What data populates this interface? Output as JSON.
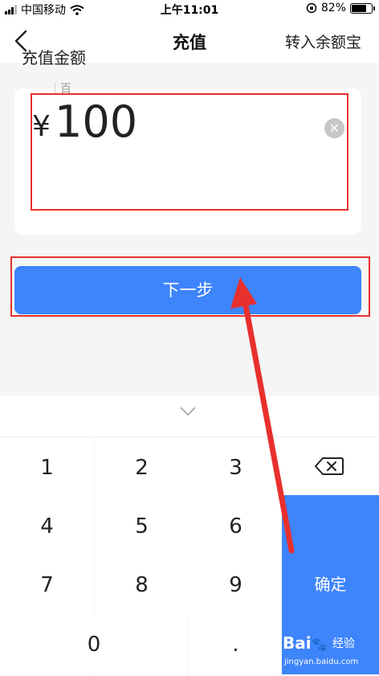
{
  "status_bar": {
    "carrier": "中国移动",
    "time": "上午11:01",
    "battery_percent": "82%",
    "battery_level": 0.82
  },
  "navbar": {
    "title": "充值",
    "right_action": "转入余额宝"
  },
  "recharge_card": {
    "label": "充值金额",
    "unit_hint": "百",
    "currency_symbol": "¥",
    "amount": "100"
  },
  "next_button": {
    "label": "下一步"
  },
  "keyboard": {
    "keys": [
      "1",
      "2",
      "3",
      "4",
      "5",
      "6",
      "7",
      "8",
      "9",
      "0",
      "."
    ],
    "confirm_label": "确定"
  },
  "watermark": {
    "logo": "Bai",
    "logo_suffix": "百度",
    "text": "经验",
    "url": "jingyan.baidu.com"
  },
  "colors": {
    "accent": "#3e84fb",
    "annotation": "#e8302e"
  }
}
